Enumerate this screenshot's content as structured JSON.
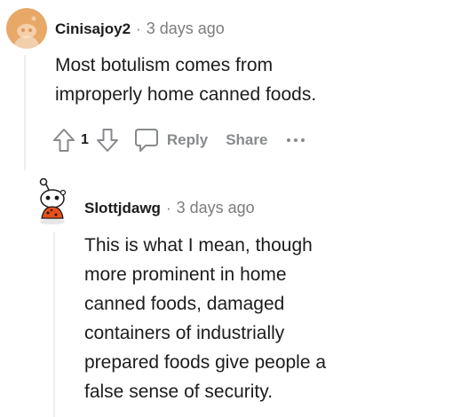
{
  "colors": {
    "meta_gray": "#7c7c7c",
    "action_gray": "#878a8c",
    "thread_line": "#edeff1",
    "avatar1_bg": "#e8a867",
    "avatar2_shirt": "#e8501c"
  },
  "comment1": {
    "username": "Cinisajoy2",
    "separator": "·",
    "timestamp": "3 days ago",
    "body_lines": [
      "Most botulism comes from",
      "improperly home canned foods."
    ],
    "vote_count": "1",
    "reply_label": "Reply",
    "share_label": "Share",
    "icons": {
      "upvote": "upvote-arrow-icon",
      "downvote": "downvote-arrow-icon",
      "reply": "speech-bubble-icon",
      "more": "more-dots-icon"
    }
  },
  "comment2": {
    "username": "Slottjdawg",
    "separator": "·",
    "timestamp": "3 days ago",
    "body_lines": [
      "This is what I mean, though",
      "more prominent in home",
      "canned foods, damaged",
      "containers of industrially",
      "prepared foods give people a",
      "false sense of security."
    ]
  }
}
